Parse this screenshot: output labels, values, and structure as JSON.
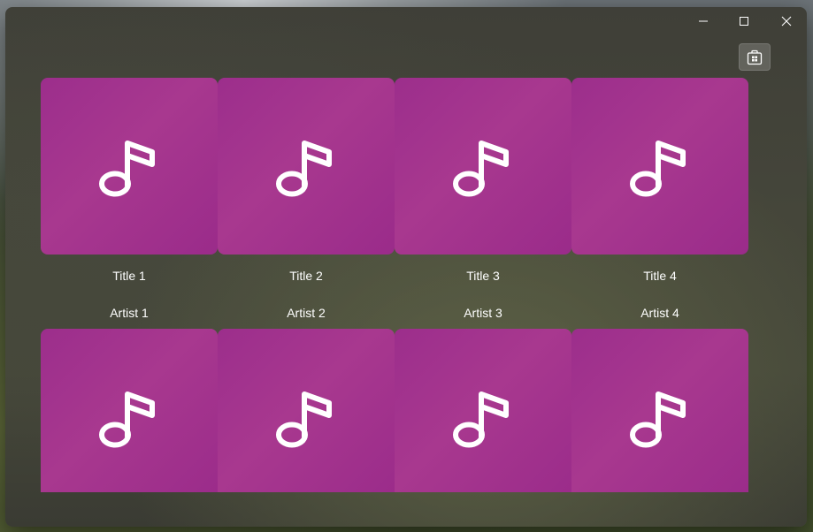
{
  "window": {
    "caption_buttons": [
      "minimize",
      "maximize",
      "close"
    ],
    "store_button": {
      "icon": "store-icon"
    }
  },
  "albums": [
    {
      "title": "Title 1",
      "artist": "Artist 1",
      "icon": "music-note-icon"
    },
    {
      "title": "Title 2",
      "artist": "Artist 2",
      "icon": "music-note-icon"
    },
    {
      "title": "Title 3",
      "artist": "Artist 3",
      "icon": "music-note-icon"
    },
    {
      "title": "Title 4",
      "artist": "Artist 4",
      "icon": "music-note-icon"
    },
    {
      "title": "",
      "artist": "",
      "icon": "music-note-icon"
    },
    {
      "title": "",
      "artist": "",
      "icon": "music-note-icon"
    },
    {
      "title": "",
      "artist": "",
      "icon": "music-note-icon"
    },
    {
      "title": "",
      "artist": "",
      "icon": "music-note-icon"
    }
  ],
  "colors": {
    "tile": "#a2338d",
    "text": "#ffffff"
  }
}
